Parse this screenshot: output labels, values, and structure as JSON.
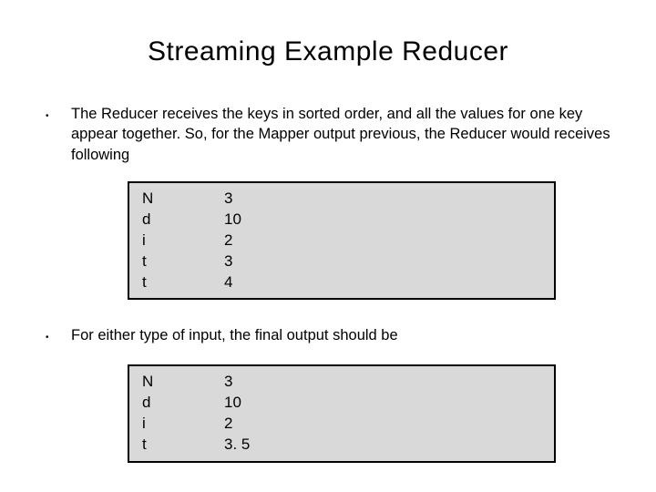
{
  "title": "Streaming Example Reducer",
  "bullet1": "The Reducer receives the keys in sorted order, and all the values for one key appear together. So, for the Mapper output previous, the Reducer would receives following",
  "bullet2": "For either type of input, the final output should be",
  "box1": {
    "r0": {
      "k": "N",
      "v": "3"
    },
    "r1": {
      "k": "d",
      "v": "10"
    },
    "r2": {
      "k": "i",
      "v": "2"
    },
    "r3": {
      "k": "t",
      "v": "3"
    },
    "r4": {
      "k": "t",
      "v": "4"
    }
  },
  "box2": {
    "r0": {
      "k": "N",
      "v": "3"
    },
    "r1": {
      "k": "d",
      "v": "10"
    },
    "r2": {
      "k": "i",
      "v": "2"
    },
    "r3": {
      "k": "t",
      "v": "3. 5"
    }
  }
}
